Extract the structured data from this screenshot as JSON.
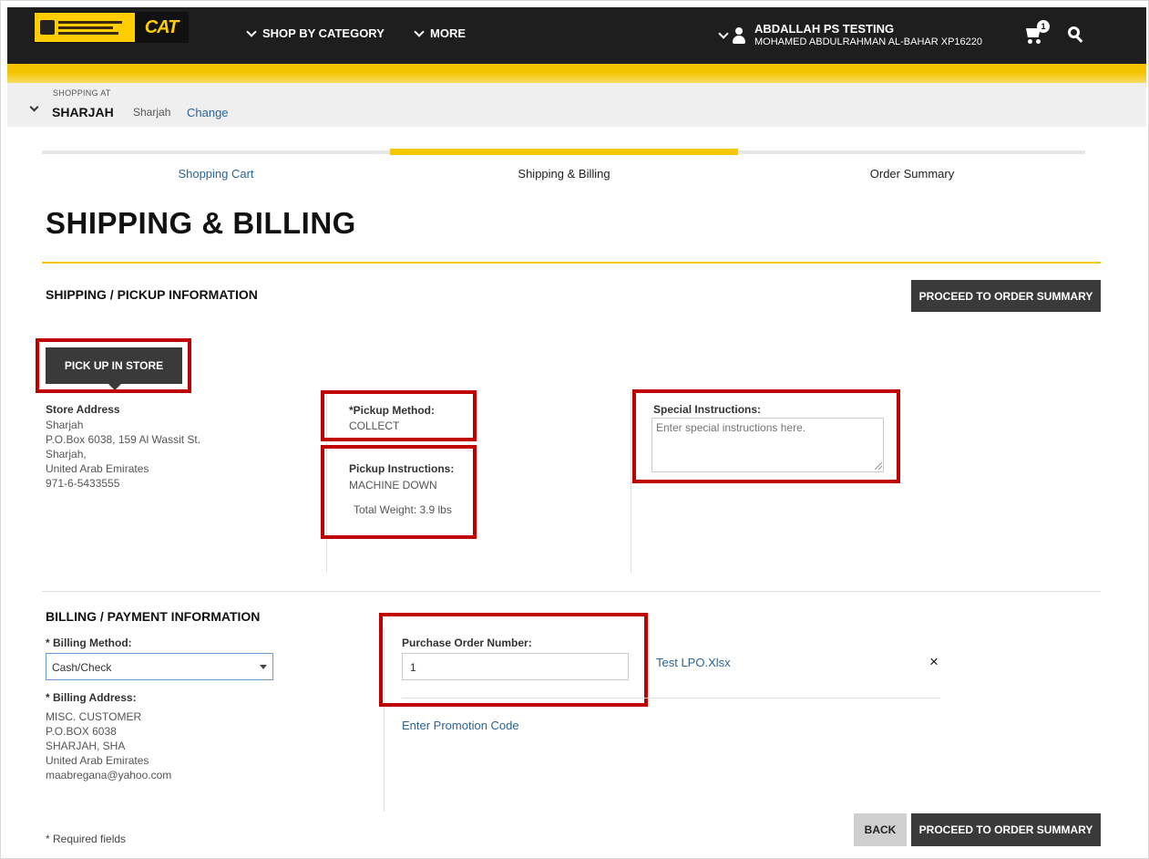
{
  "header": {
    "logo_cat": "CAT",
    "nav_shop": "SHOP BY CATEGORY",
    "nav_more": "MORE",
    "user_name": "ABDALLAH PS TESTING",
    "user_org": "MOHAMED ABDULRAHMAN AL-BAHAR XP16220",
    "cart_count": "1"
  },
  "shopping_at": {
    "label": "SHOPPING AT",
    "city": "SHARJAH",
    "store": "Sharjah",
    "change": "Change"
  },
  "steps": [
    "Shopping Cart",
    "Shipping & Billing",
    "Order Summary"
  ],
  "page_title": "SHIPPING & BILLING",
  "shipping": {
    "heading": "SHIPPING / PICKUP INFORMATION",
    "proceed": "PROCEED TO ORDER SUMMARY",
    "pickup_tab": "PICK UP IN STORE",
    "store_address_label": "Store Address",
    "store_address": [
      "Sharjah",
      "P.O.Box 6038, 159 Al Wassit St.",
      "Sharjah,",
      "United Arab Emirates",
      "971-6-5433555"
    ],
    "pickup_method_label": "*Pickup Method:",
    "pickup_method_value": "COLLECT",
    "pickup_instructions_label": "Pickup Instructions:",
    "pickup_instructions_value": "MACHINE DOWN",
    "total_weight": "Total Weight: 3.9 lbs",
    "special_label": "Special Instructions:",
    "special_placeholder": "Enter special instructions here."
  },
  "billing": {
    "heading": "BILLING / PAYMENT INFORMATION",
    "method_label": "* Billing Method:",
    "method_value": "Cash/Check",
    "address_label": "* Billing Address:",
    "address": [
      "MISC. CUSTOMER",
      "P.O.BOX 6038",
      "SHARJAH, SHA",
      "United Arab Emirates",
      "maabregana@yahoo.com"
    ],
    "po_label": "Purchase Order Number:",
    "po_value": "1",
    "attachment": "Test LPO.Xlsx",
    "remove": "×",
    "promo": "Enter Promotion Code"
  },
  "footer": {
    "required": "* Required fields",
    "back": "BACK",
    "proceed": "PROCEED TO ORDER SUMMARY"
  },
  "colors": {
    "brand_yellow": "#f5c800",
    "header_dark": "#1e1e1e",
    "highlight_red": "#c00000",
    "link_blue": "#2a6496"
  }
}
